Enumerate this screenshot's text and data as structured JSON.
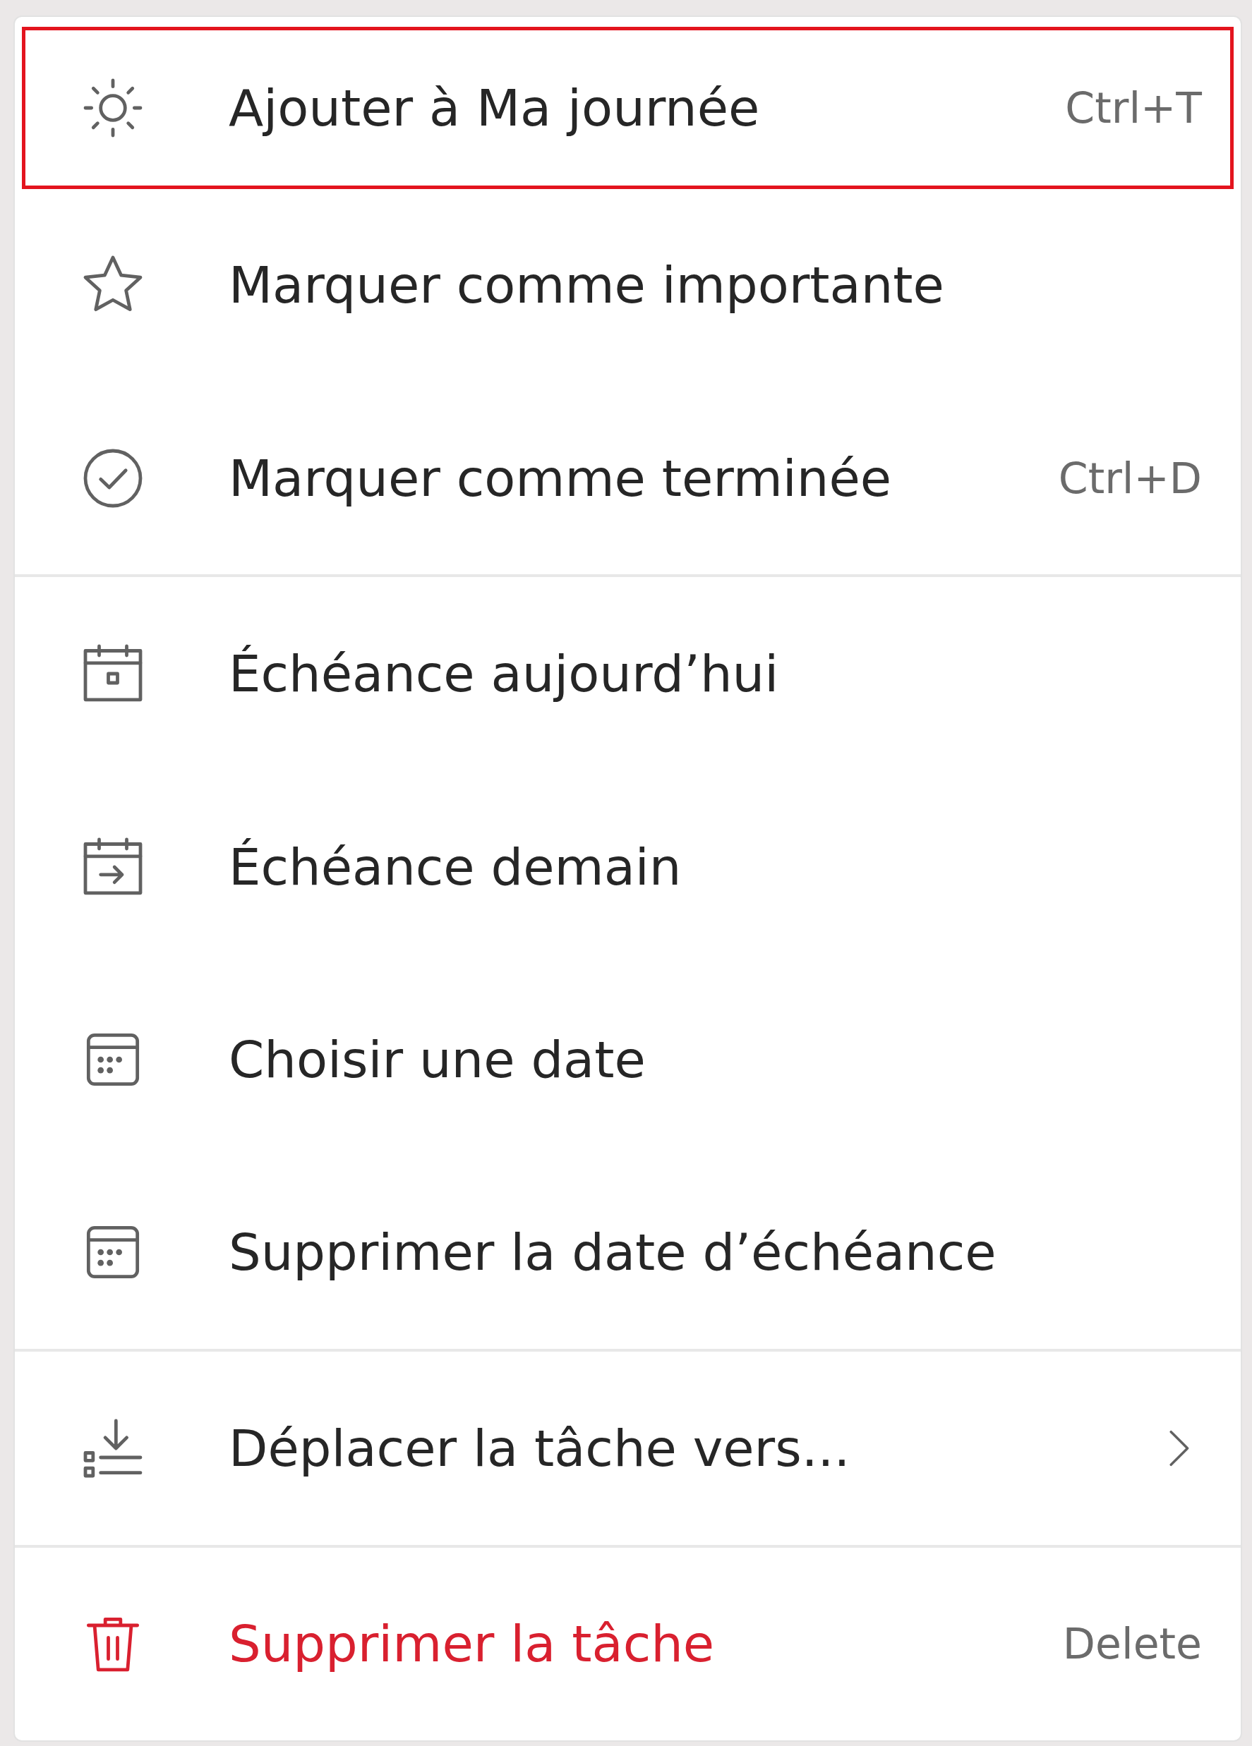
{
  "menu": {
    "sections": [
      {
        "items": [
          {
            "label": "Ajouter à Ma journée",
            "shortcut": "Ctrl+T",
            "selected": true,
            "danger": false,
            "has_submenu": false
          },
          {
            "label": "Marquer comme importante",
            "selected": false,
            "danger": false,
            "has_submenu": false
          },
          {
            "label": "Marquer comme terminée",
            "shortcut": "Ctrl+D",
            "selected": false,
            "danger": false,
            "has_submenu": false
          }
        ]
      },
      {
        "items": [
          {
            "label": "Échéance aujourd’hui",
            "selected": false,
            "danger": false,
            "has_submenu": false
          },
          {
            "label": "Échéance demain",
            "selected": false,
            "danger": false,
            "has_submenu": false
          },
          {
            "label": "Choisir une date",
            "selected": false,
            "danger": false,
            "has_submenu": false
          },
          {
            "label": "Supprimer la date d’échéance",
            "selected": false,
            "danger": false,
            "has_submenu": false
          }
        ]
      },
      {
        "items": [
          {
            "label": "Déplacer la tâche vers...",
            "selected": false,
            "danger": false,
            "has_submenu": true
          }
        ]
      },
      {
        "items": [
          {
            "label": "Supprimer la tâche",
            "shortcut": "Delete",
            "selected": false,
            "danger": true,
            "has_submenu": false
          }
        ]
      }
    ]
  }
}
